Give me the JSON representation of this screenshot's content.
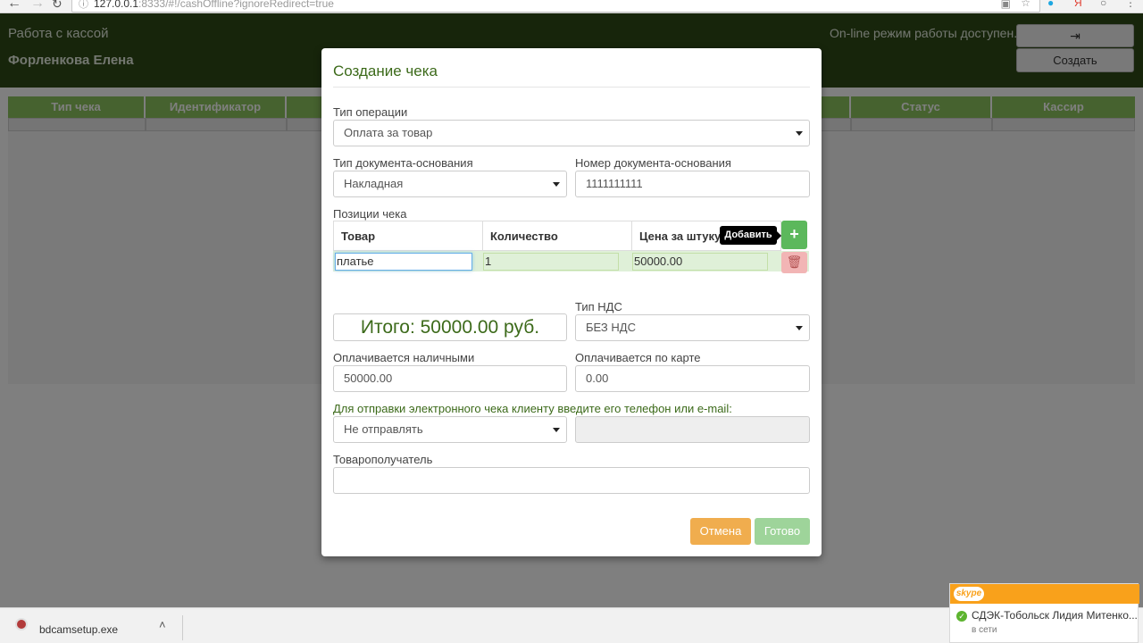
{
  "browser": {
    "url_host": "127.0.0.1",
    "url_rest": ":8333/#!/cashOffline?ignoreRedirect=true"
  },
  "app": {
    "title": "Работа с кассой",
    "user": "Форленкова Елена",
    "online_status": "On-line режим работы доступен.",
    "create_button": "Создать",
    "grid_columns": [
      "Тип чека",
      "Идентификатор",
      "",
      "",
      "",
      "",
      "Статус",
      "Кассир"
    ]
  },
  "modal": {
    "title": "Создание чека",
    "operation_type": {
      "label": "Тип операции",
      "value": "Оплата за товар"
    },
    "doc_type": {
      "label": "Тип документа-основания",
      "value": "Накладная"
    },
    "doc_number": {
      "label": "Номер документа-основания",
      "value": "1111111111"
    },
    "items": {
      "label": "Позиции чека",
      "headers": [
        "Товар",
        "Количество",
        "Цена за штуку"
      ],
      "rows": [
        {
          "name": "платье",
          "quantity": "1",
          "price": "50000.00"
        }
      ],
      "add_tooltip": "Добавить"
    },
    "total": "Итого: 50000.00 руб.",
    "vat_type": {
      "label": "Тип НДС",
      "value": "БЕЗ НДС"
    },
    "cash": {
      "label": "Оплачивается наличными",
      "value": "50000.00"
    },
    "card": {
      "label": "Оплачивается по карте",
      "value": "0.00"
    },
    "send_hint": "Для отправки электронного чека клиенту введите его телефон или e-mail:",
    "send_select": "Не отправлять",
    "recipient": {
      "label": "Товарополучатель",
      "value": ""
    },
    "cancel_button": "Отмена",
    "done_button": "Готово"
  },
  "downloads": {
    "file": "bdcamsetup.exe"
  },
  "skype": {
    "logo": "skype",
    "contact": "СДЭК-Тобольск Лидия Митенко...",
    "status": "в сети"
  },
  "colors": {
    "header_bg": "#2f4a16",
    "grid_header": "#8cc55e",
    "title_green": "#3c6a1a",
    "add_green": "#5cb85c",
    "cancel_orange": "#f0ad4e",
    "done_green": "#9ed49a",
    "skype_orange": "#f9a11b"
  }
}
